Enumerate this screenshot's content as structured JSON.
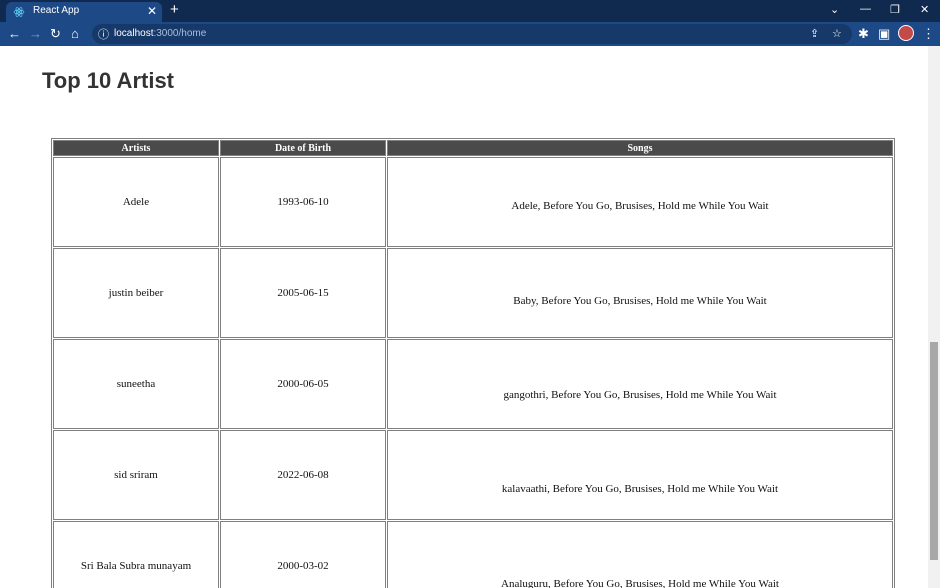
{
  "browser": {
    "tab_title": "React App",
    "url_host": "localhost",
    "url_path": ":3000/home"
  },
  "page": {
    "title": "Top 10 Artist"
  },
  "table": {
    "headers": [
      "Artists",
      "Date of Birth",
      "Songs"
    ],
    "rows": [
      {
        "artist": "Adele",
        "dob": "1993-06-10",
        "songs": "Adele, Before You Go, Brusises, Hold me While You Wait"
      },
      {
        "artist": "justin beiber",
        "dob": "2005-06-15",
        "songs": "Baby, Before You Go, Brusises, Hold me While You Wait"
      },
      {
        "artist": "suneetha",
        "dob": "2000-06-05",
        "songs": "gangothri, Before You Go, Brusises, Hold me While You Wait"
      },
      {
        "artist": "sid sriram",
        "dob": "2022-06-08",
        "songs": "kalavaathi, Before You Go, Brusises, Hold me While You Wait"
      },
      {
        "artist": "Sri Bala Subra munayam",
        "dob": "2000-03-02",
        "songs": "Analuguru, Before You Go, Brusises, Hold me While You Wait"
      }
    ]
  },
  "icons": {
    "back": "back-arrow-icon",
    "forward": "forward-arrow-icon",
    "reload": "reload-icon",
    "home": "home-icon",
    "info": "info-icon",
    "share": "share-icon",
    "bookmark": "star-icon",
    "extensions": "puzzle-icon",
    "sidepanel": "side-panel-icon",
    "menu": "kebab-menu-icon"
  },
  "colors": {
    "titlebar": "#0f2a4e",
    "toolbar": "#1d4a86",
    "table_header": "#4a4a4a"
  }
}
